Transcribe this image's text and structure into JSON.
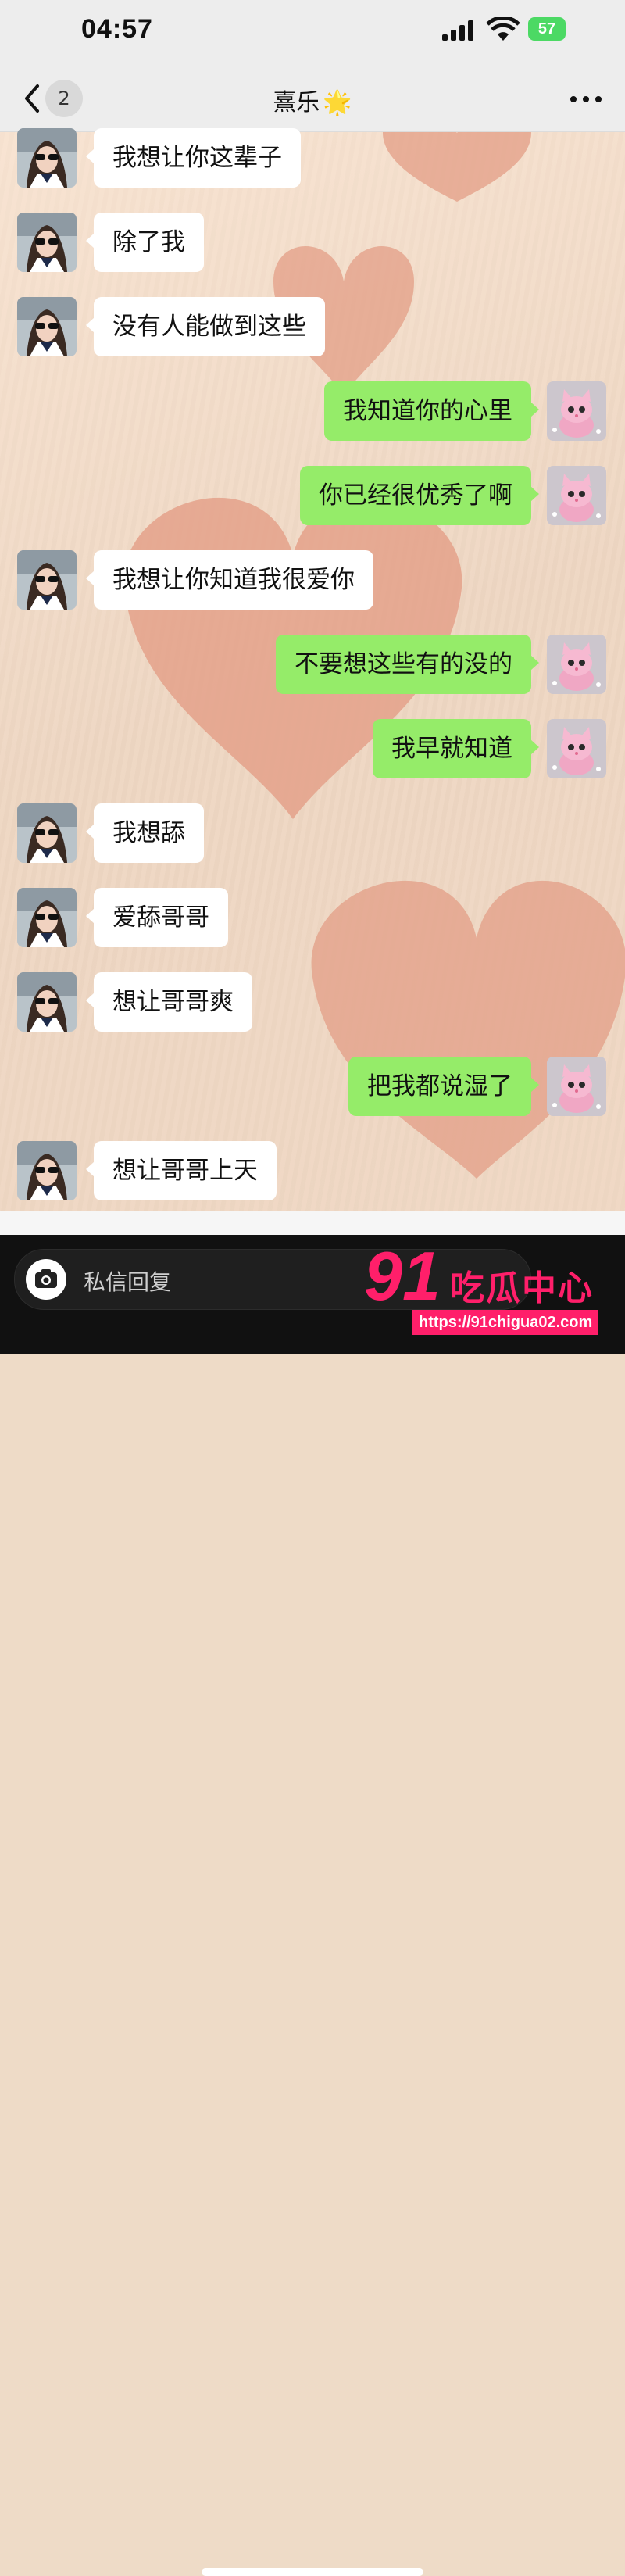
{
  "status_bar": {
    "time": "04:57",
    "battery": "57"
  },
  "nav": {
    "back_label": "<",
    "unread_count": "2",
    "title": "熹乐",
    "title_emoji": "🌟",
    "more_label": "···"
  },
  "messages": [
    {
      "side": "left",
      "text": "我想让你这辈子"
    },
    {
      "side": "left",
      "text": "除了我"
    },
    {
      "side": "left",
      "text": "没有人能做到这些"
    },
    {
      "side": "right",
      "text": "我知道你的心里"
    },
    {
      "side": "right",
      "text": "你已经很优秀了啊"
    },
    {
      "side": "left",
      "text": "我想让你知道我很爱你"
    },
    {
      "side": "right",
      "text": "不要想这些有的没的"
    },
    {
      "side": "right",
      "text": "我早就知道"
    },
    {
      "side": "left",
      "text": "我想舔"
    },
    {
      "side": "left",
      "text": "爱舔哥哥"
    },
    {
      "side": "left",
      "text": "想让哥哥爽"
    },
    {
      "side": "right",
      "text": "把我都说湿了"
    },
    {
      "side": "left",
      "text": "想让哥哥上天"
    }
  ],
  "input": {
    "placeholder": "私信回复"
  },
  "watermark": {
    "number": "91",
    "name": "吃瓜中心",
    "url": "https://91chigua02.com"
  },
  "colors": {
    "left_bubble": "#ffffff",
    "right_bubble": "#95ec69",
    "watermark": "#ff1f6a"
  }
}
